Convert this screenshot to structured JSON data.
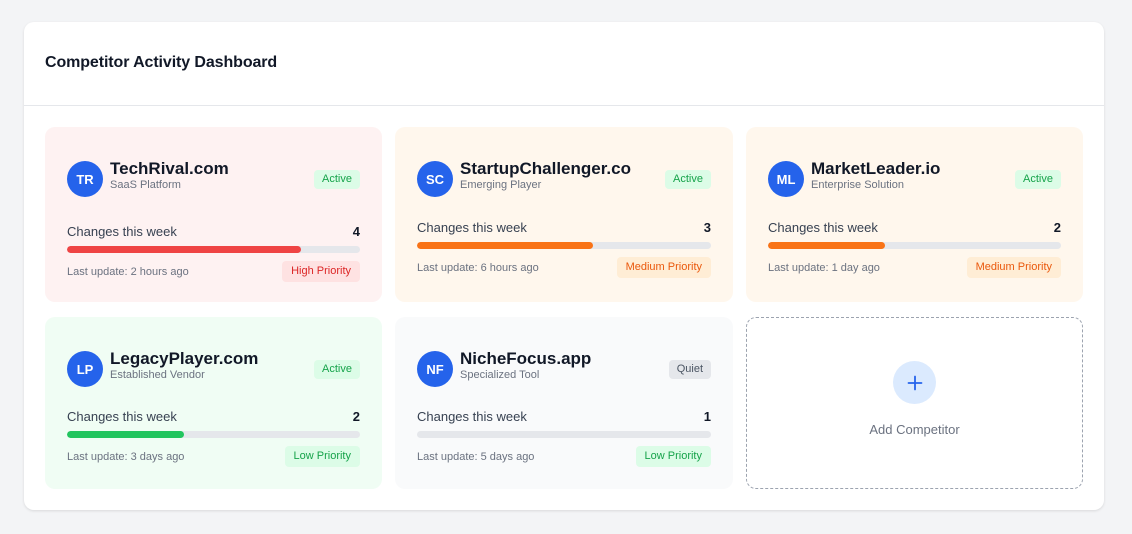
{
  "dashboard": {
    "title": "Competitor Activity Dashboard"
  },
  "competitors": [
    {
      "initials": "TR",
      "name": "TechRival.com",
      "subtitle": "SaaS Platform",
      "status": "Active",
      "status_type": "active",
      "changes_label": "Changes this week",
      "changes": "4",
      "activity_fraction": 0.8,
      "bar_color": "#ef4444",
      "card_bg": "#fef2f2",
      "last_update": "Last update: 2 hours ago",
      "priority": "High Priority",
      "priority_type": "high"
    },
    {
      "initials": "SC",
      "name": "StartupChallenger.co",
      "subtitle": "Emerging Player",
      "status": "Active",
      "status_type": "active",
      "changes_label": "Changes this week",
      "changes": "3",
      "activity_fraction": 0.6,
      "bar_color": "#f97316",
      "card_bg": "#fff7ed",
      "last_update": "Last update: 6 hours ago",
      "priority": "Medium Priority",
      "priority_type": "medium"
    },
    {
      "initials": "ML",
      "name": "MarketLeader.io",
      "subtitle": "Enterprise Solution",
      "status": "Active",
      "status_type": "active",
      "changes_label": "Changes this week",
      "changes": "2",
      "activity_fraction": 0.4,
      "bar_color": "#f97316",
      "card_bg": "#fff7ed",
      "last_update": "Last update: 1 day ago",
      "priority": "Medium Priority",
      "priority_type": "medium"
    },
    {
      "initials": "LP",
      "name": "LegacyPlayer.com",
      "subtitle": "Established Vendor",
      "status": "Active",
      "status_type": "active",
      "changes_label": "Changes this week",
      "changes": "2",
      "activity_fraction": 0.4,
      "bar_color": "#22c55e",
      "card_bg": "#f0fdf4",
      "last_update": "Last update: 3 days ago",
      "priority": "Low Priority",
      "priority_type": "low"
    },
    {
      "initials": "NF",
      "name": "NicheFocus.app",
      "subtitle": "Specialized Tool",
      "status": "Quiet",
      "status_type": "quiet",
      "changes_label": "Changes this week",
      "changes": "1",
      "activity_fraction": 0.0,
      "bar_color": "#9ca3af",
      "card_bg": "#f9fafb",
      "last_update": "Last update: 5 days ago",
      "priority": "Low Priority",
      "priority_type": "low"
    }
  ],
  "add_card": {
    "icon": "plus-icon",
    "label": "Add Competitor"
  },
  "colors": {
    "avatar": "#2563eb",
    "accent": "#2563eb"
  }
}
